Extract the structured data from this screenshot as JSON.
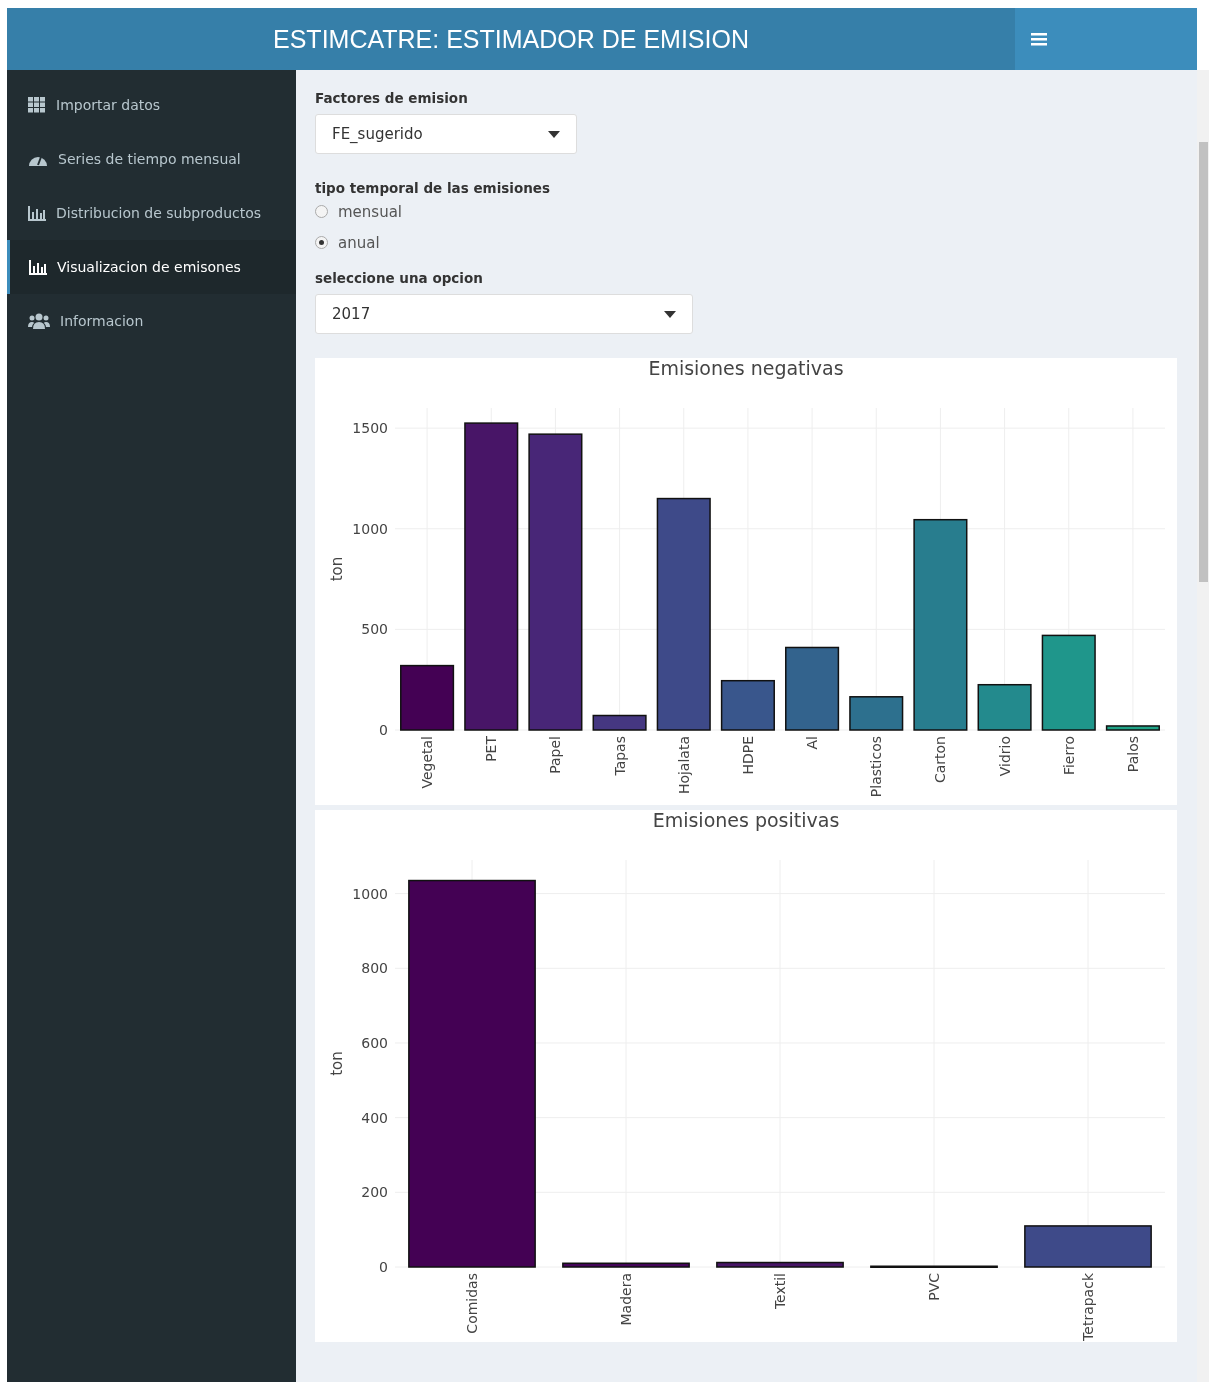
{
  "header": {
    "title": "ESTIMCATRE: ESTIMADOR DE EMISION"
  },
  "sidebar": {
    "items": [
      {
        "label": "Importar datos",
        "selected": false
      },
      {
        "label": "Series de tiempo mensual",
        "selected": false
      },
      {
        "label": "Distribucion de subproductos",
        "selected": false
      },
      {
        "label": "Visualizacion de emisones",
        "selected": true
      },
      {
        "label": "Informacion",
        "selected": false
      }
    ]
  },
  "controls": {
    "emission_factors": {
      "label": "Factores de emision",
      "value": "FE_sugerido"
    },
    "time_type": {
      "label": "tipo temporal de las emisiones",
      "options": [
        {
          "label": "mensual",
          "selected": false
        },
        {
          "label": "anual",
          "selected": true
        }
      ]
    },
    "option": {
      "label": "seleccione una opcion",
      "value": "2017"
    }
  },
  "charts": [
    {
      "chart_data": {
        "type": "bar",
        "title": "Emisiones negativas",
        "ylabel": "ton",
        "grid": true,
        "categories": [
          "Vegetal",
          "PET",
          "Papel",
          "Tapas",
          "Hojalata",
          "HDPE",
          "Al",
          "Plasticos",
          "Carton",
          "Vidrio",
          "Fierro",
          "Palos"
        ],
        "series": [
          {
            "color": "#440154",
            "values": [
              320,
              null,
              null,
              null,
              null,
              null,
              null,
              null,
              null,
              null,
              null,
              null
            ]
          },
          {
            "color": "#481567",
            "values": [
              null,
              1525,
              null,
              null,
              null,
              null,
              null,
              null,
              null,
              null,
              null,
              null
            ]
          },
          {
            "color": "#482677",
            "values": [
              null,
              null,
              1470,
              null,
              null,
              null,
              null,
              null,
              null,
              null,
              null,
              null
            ]
          },
          {
            "color": "#453781",
            "values": [
              null,
              null,
              null,
              72,
              null,
              null,
              null,
              null,
              null,
              null,
              null,
              null
            ]
          },
          {
            "color": "#3e4a89",
            "values": [
              null,
              null,
              null,
              null,
              1150,
              null,
              null,
              null,
              null,
              null,
              null,
              null
            ]
          },
          {
            "color": "#39568c",
            "values": [
              null,
              null,
              null,
              null,
              null,
              245,
              null,
              null,
              null,
              null,
              null,
              null
            ]
          },
          {
            "color": "#33638d",
            "values": [
              null,
              null,
              null,
              null,
              null,
              null,
              410,
              null,
              null,
              null,
              null,
              null
            ]
          },
          {
            "color": "#2d708e",
            "values": [
              null,
              null,
              null,
              null,
              null,
              null,
              null,
              165,
              null,
              null,
              null,
              null
            ]
          },
          {
            "color": "#287d8e",
            "values": [
              null,
              null,
              null,
              null,
              null,
              null,
              null,
              null,
              1045,
              null,
              null,
              null
            ]
          },
          {
            "color": "#238a8d",
            "values": [
              null,
              null,
              null,
              null,
              null,
              null,
              null,
              null,
              null,
              225,
              null,
              null
            ]
          },
          {
            "color": "#1f968b",
            "values": [
              null,
              null,
              null,
              null,
              null,
              null,
              null,
              null,
              null,
              null,
              470,
              null
            ]
          },
          {
            "color": "#20a387",
            "values": [
              null,
              null,
              null,
              null,
              null,
              null,
              null,
              null,
              null,
              null,
              null,
              20
            ]
          }
        ],
        "ylim": [
          0,
          1600
        ],
        "yticks": [
          0,
          500,
          1000,
          1500
        ]
      }
    },
    {
      "chart_data": {
        "type": "bar",
        "title": "Emisiones positivas",
        "ylabel": "ton",
        "grid": true,
        "categories": [
          "Comidas",
          "Madera",
          "Textil",
          "PVC",
          "Tetrapack"
        ],
        "series": [
          {
            "color": "#440154",
            "values": [
              1035,
              null,
              null,
              null,
              null
            ]
          },
          {
            "color": "#45055a",
            "values": [
              null,
              10,
              null,
              null,
              null
            ]
          },
          {
            "color": "#481567",
            "values": [
              null,
              null,
              12,
              null,
              null
            ]
          },
          {
            "color": "#39568c",
            "values": [
              null,
              null,
              null,
              2,
              null
            ]
          },
          {
            "color": "#3e4a89",
            "values": [
              null,
              null,
              null,
              null,
              110
            ]
          }
        ],
        "ylim": [
          0,
          1090
        ],
        "yticks": [
          0,
          200,
          400,
          600,
          800,
          1000
        ]
      }
    }
  ]
}
